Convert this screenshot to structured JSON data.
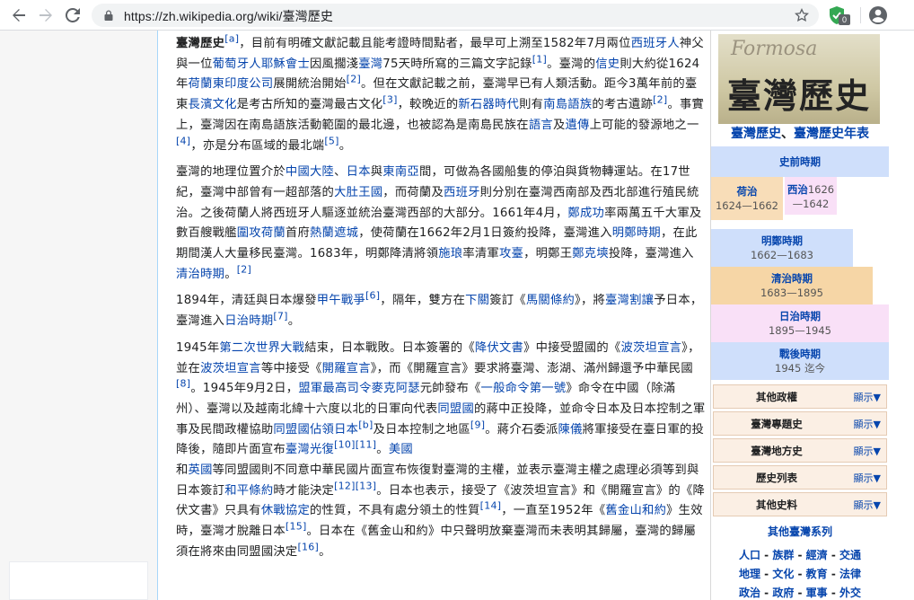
{
  "browser": {
    "url": "https://zh.wikipedia.org/wiki/臺灣歷史",
    "extension_badge": "0",
    "icons": [
      "back-arrow-icon",
      "forward-arrow-icon",
      "reload-icon",
      "lock-icon",
      "star-icon",
      "extension-shield-icon",
      "account-icon"
    ]
  },
  "colors": {
    "link": "#0645ad",
    "infobox_blue": "#cfdffb",
    "infobox_orange": "#f8ddb8",
    "infobox_pink": "#f9e0f7"
  },
  "article": {
    "p1": {
      "t0": "臺灣歷史",
      "r0": "[a]",
      "t1": "，目前有明確文獻記載且能考證時間點者，最早可上溯至1582年7月兩位",
      "l1": "西班牙人",
      "t2": "神父與一位",
      "l2": "葡萄牙人",
      "l3": "耶穌會士",
      "t3": "因風擱淺",
      "l4": "臺灣",
      "t4": "75天時所寫的三篇文字記錄",
      "r1": "[1]",
      "t5": "。臺灣的",
      "l5": "信史",
      "t6": "則大約從1624年",
      "l6": "荷蘭東印度公司",
      "t7": "展開統治開始",
      "r2": "[2]",
      "t8": "。但在文獻記載之前，臺灣早已有人類活動。距今3萬年前的臺東",
      "l7": "長濱文化",
      "t9": "是考古所知的臺灣最古文化",
      "r3": "[3]",
      "t10": "，較晚近的",
      "l8": "新石器時代",
      "t11": "則有",
      "l9": "南島語族",
      "t12": "的考古遺跡",
      "r4": "[2]",
      "t13": "。事實上，臺灣因在南島語族活動範圍的最北邊，也被認為是南島民族在",
      "l10": "語言",
      "t14": "及",
      "l11": "遺傳",
      "t15": "上可能的發源地之一",
      "r5": "[4]",
      "t16": "，亦是分布區域的最北端",
      "r6": "[5]",
      "t17": "。"
    },
    "p2": {
      "t0": "臺灣的地理位置介於",
      "l0": "中國大陸",
      "t1": "、",
      "l1": "日本",
      "t2": "與",
      "l2": "東南亞",
      "t3": "間，可做為各國船隻的停泊與貨物轉運站。在17世紀，臺灣中部曾有一超部落的",
      "l3": "大肚王國",
      "t4": "，而荷蘭及",
      "l4": "西班牙",
      "t5": "則分別在臺灣西南部及西北部進行殖民統治。之後荷蘭人將西班牙人驅逐並統治臺灣西部的大部分。1661年4月，",
      "l5": "鄭成功",
      "t6": "率兩萬五千大軍及數百艘戰艦",
      "l6": "圍攻荷蘭",
      "t7": "首府",
      "l7": "熱蘭遮城",
      "t8": "，使荷蘭在1662年2月1日簽約投降，臺灣進入",
      "l8": "明鄭時期",
      "t9": "，在此期間漢人大量移民臺灣。1683年，明鄭降清將領",
      "l9": "施琅",
      "t10": "率清軍",
      "l10": "攻臺",
      "t11": "，明鄭王",
      "l11": "鄭克塽",
      "t12": "投降，臺灣進入",
      "l12": "清治時期",
      "t13": "。",
      "r0": "[2]"
    },
    "p3": {
      "t0": "1894年，清廷與日本爆發",
      "l0": "甲午戰爭",
      "r0": "[6]",
      "t1": "，隔年，雙方在",
      "l1": "下關",
      "t2": "簽訂《",
      "l2": "馬關條約",
      "t3": "》，將",
      "l3": "臺灣割讓",
      "t4": "予日本，臺灣進入",
      "l4": "日治時期",
      "r1": "[7]",
      "t5": "。"
    },
    "p4": {
      "t0": "1945年",
      "l0": "第二次世界大戰",
      "t1": "結束，日本戰敗。日本簽署的《",
      "l1": "降伏文書",
      "t2": "》中接受盟國的《",
      "l2": "波茨坦宣言",
      "t3": "》，並在",
      "l3": "波茨坦宣言",
      "t4": "等中接受《",
      "l4": "開羅宣言",
      "t5": "》，而《開羅宣言》要求將臺灣、澎湖、滿州歸還予中華民國",
      "r0": "[8]",
      "t6": "。1945年9月2日，",
      "l5": "盟軍最高司令麥克阿瑟",
      "t7": "元帥發布《",
      "l6": "一般命令第一號",
      "t8": "》命令在中國（除滿州）、臺灣以及越南北緯十六度以北的日軍向代表",
      "l7": "同盟國",
      "t9": "的蔣中正投降，並命令日本及日本控制之軍事及民間政權協助",
      "l8": "同盟國佔領日本",
      "r1": "[b]",
      "t10": "及日本控制之地區",
      "r2": "[9]",
      "t11": "。蔣介石委派",
      "l9": "陳儀",
      "t12": "將軍接受在臺日軍的投降後，隨即片面宣布",
      "l10": "臺灣光復",
      "r3": "[10]",
      "r4": "[11]",
      "t13": "。",
      "l11": "美國",
      "t14": "和",
      "l12": "英國",
      "t15": "等同盟國則不同意中華民國片面宣布恢復對臺灣的主權，並表示臺灣主權之處理必須等到與日本簽訂",
      "l13": "和平條約",
      "t16": "時才能決定",
      "r5": "[12]",
      "r6": "[13]",
      "t17": "。日本也表示，接受了《波茨坦宣言》和《開羅宣言》的《降伏文書》只具有",
      "l14": "休戰協定",
      "t18": "的性質，不具有處分領土的性質",
      "r7": "[14]",
      "t19": "，一直至1952年《",
      "l15": "舊金山和約",
      "t20": "》生效時，臺灣才脫離日本",
      "r8": "[15]",
      "t21": "。日本在《舊金山和約》中只聲明放棄臺灣而未表明其歸屬，臺灣的歸屬須在將來由同盟國決定",
      "r9": "[16]",
      "t22": "。"
    }
  },
  "infobox": {
    "image_subtitle": "Formosa",
    "image_title": "臺灣歷史",
    "caption_l1": "臺灣歷史",
    "caption_sep": "、",
    "caption_l2": "臺灣歷史年表",
    "periods": {
      "shiqian": {
        "name": "史前時期"
      },
      "hezhi": {
        "name": "荷治",
        "years": "1624—1662"
      },
      "xizhi": {
        "name": "西治",
        "years_a": "1626",
        "years_b": "—1642"
      },
      "mingzheng": {
        "name": "明鄭時期",
        "years": "1662—1683"
      },
      "qingzhi": {
        "name": "清治時期",
        "years": "1683—1895"
      },
      "rizhi": {
        "name": "日治時期",
        "years": "1895—1945"
      },
      "zhanhou": {
        "name": "戰後時期",
        "years": "1945 迄今"
      }
    },
    "nav_rows": [
      {
        "title": "其他政權",
        "toggle": "顯示▼"
      },
      {
        "title": "臺灣專題史",
        "toggle": "顯示▼"
      },
      {
        "title": "臺灣地方史",
        "toggle": "顯示▼"
      },
      {
        "title": "歷史列表",
        "toggle": "顯示▼"
      },
      {
        "title": "其他史料",
        "toggle": "顯示▼"
      }
    ],
    "more_title": "其他臺灣系列",
    "more_row1": [
      "人口",
      "族群",
      "經濟",
      "交通"
    ],
    "more_row2": [
      "地理",
      "文化",
      "教育",
      "法律"
    ],
    "more_row3": [
      "政治",
      "政府",
      "軍事",
      "外交"
    ],
    "more_sep": " - "
  }
}
